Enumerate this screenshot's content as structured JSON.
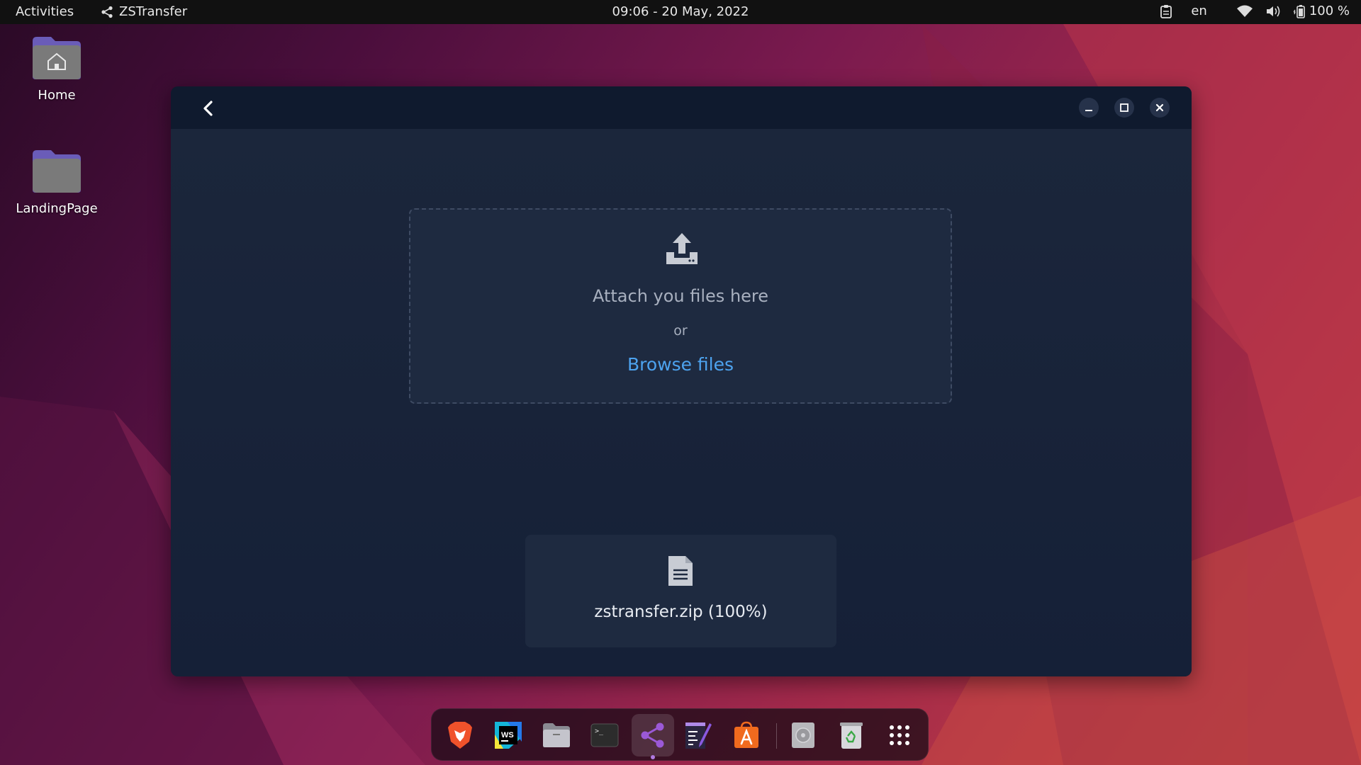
{
  "topbar": {
    "activities": "Activities",
    "app_name": "ZSTransfer",
    "clock": "09:06 - 20 May, 2022",
    "language": "en",
    "battery": "100 %"
  },
  "desktop": {
    "icons": [
      {
        "label": "Home"
      },
      {
        "label": "LandingPage"
      }
    ]
  },
  "window": {
    "dropzone": {
      "attach_text": "Attach you files here",
      "or_text": "or",
      "browse_text": "Browse files"
    },
    "file": {
      "name": "zstransfer.zip (100%)"
    }
  },
  "dock": {
    "items": [
      "brave-browser-icon",
      "webstorm-icon",
      "files-icon",
      "terminal-icon",
      "zstransfer-share-icon",
      "text-editor-icon",
      "app-store-icon",
      "disk-icon",
      "trash-icon",
      "show-apps-grid-icon"
    ]
  },
  "colors": {
    "window_bg": "#18233a",
    "titlebar_bg": "#0f1a2e",
    "accent_link": "#4da3ef",
    "topbar_bg": "#111111"
  }
}
